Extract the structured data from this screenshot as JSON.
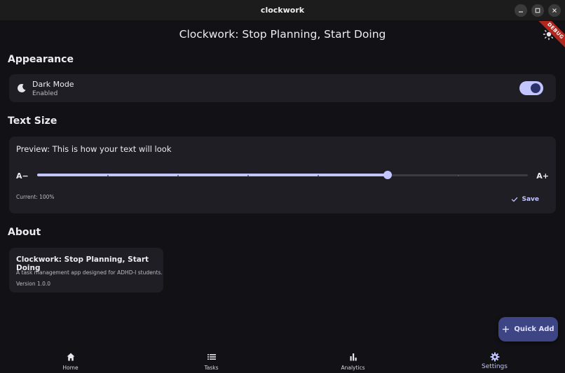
{
  "window": {
    "title": "clockwork"
  },
  "appbar": {
    "title": "Clockwork: Stop Planning, Start Doing",
    "debug_banner": "DEBUG"
  },
  "appearance": {
    "heading": "Appearance",
    "dark_mode": {
      "label": "Dark Mode",
      "status": "Enabled",
      "enabled": true
    }
  },
  "text_size": {
    "heading": "Text Size",
    "preview": "Preview: This is how your text will look",
    "decrease_label": "A−",
    "increase_label": "A+",
    "slider_fraction": 0.714,
    "current": "Current: 100%",
    "save_label": "Save"
  },
  "about": {
    "heading": "About",
    "title": "Clockwork: Stop Planning, Start Doing",
    "description": "A task management app designed for ADHD-I students.",
    "version": "Version 1.0.0"
  },
  "fab": {
    "label": "Quick Add"
  },
  "nav": {
    "items": [
      {
        "label": "Home",
        "icon": "home-icon"
      },
      {
        "label": "Tasks",
        "icon": "list-icon"
      },
      {
        "label": "Analytics",
        "icon": "bar-chart-icon"
      },
      {
        "label": "Settings",
        "icon": "gear-icon",
        "active": true
      }
    ]
  },
  "colors": {
    "accent": "#c2c5ff",
    "surface": "#1e1e24",
    "background": "#121216",
    "fab": "#3e4584"
  }
}
